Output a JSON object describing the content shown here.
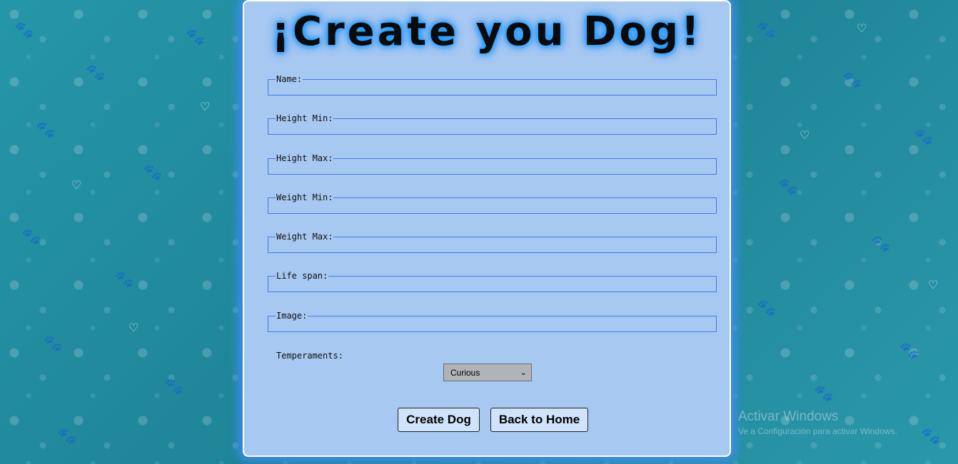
{
  "page": {
    "title": "¡Create you Dog!"
  },
  "form": {
    "fields": [
      {
        "label": "Name:",
        "value": ""
      },
      {
        "label": "Height Min:",
        "value": ""
      },
      {
        "label": "Height Max:",
        "value": ""
      },
      {
        "label": "Weight Min:",
        "value": ""
      },
      {
        "label": "Weight Max:",
        "value": ""
      },
      {
        "label": "Life span:",
        "value": ""
      },
      {
        "label": "Image:",
        "value": ""
      }
    ],
    "temperaments": {
      "label": "Temperaments:",
      "selected": "Curious"
    },
    "create_button": "Create Dog",
    "back_button": "Back to Home"
  },
  "watermark": {
    "title": "Activar Windows",
    "subtitle": "Ve a Configuración para activar Windows."
  },
  "colors": {
    "background": "#2a8c9e",
    "panel": "#a6c8f1",
    "field_border": "#4a78e8",
    "title_glow": "#1ea0ff"
  }
}
